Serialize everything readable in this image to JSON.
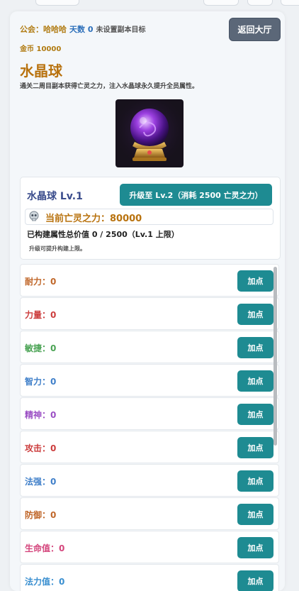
{
  "header": {
    "guild_label": "公会：哈哈哈",
    "days_label": "天数 0",
    "goal_label": "未设置副本目标",
    "gold_label": "金币 10000",
    "back_button": "返回大厅"
  },
  "crystal": {
    "title": "水晶球",
    "description": "通关二周目副本获得亡灵之力，注入水晶球永久提升全员属性。",
    "image_icon": "crystal-ball-icon",
    "level_label": "水晶球 Lv.1",
    "upgrade_button": "升级至 Lv.2（消耗 2500 亡灵之力）",
    "undead_power_label": "当前亡灵之力：80000",
    "total_label": "已构建属性总价值 0 / 2500（Lv.1 上限）",
    "hint": "升级可提升构建上限。"
  },
  "attributes": [
    {
      "label": "耐力：",
      "value": "0",
      "color": "#c0672a",
      "button": "加点"
    },
    {
      "label": "力量：",
      "value": "0",
      "color": "#cc3d3d",
      "button": "加点"
    },
    {
      "label": "敏捷：",
      "value": "0",
      "color": "#4aa354",
      "button": "加点"
    },
    {
      "label": "智力：",
      "value": "0",
      "color": "#3f7fc9",
      "button": "加点"
    },
    {
      "label": "精神：",
      "value": "0",
      "color": "#9b4fc4",
      "button": "加点"
    },
    {
      "label": "攻击：",
      "value": "0",
      "color": "#cc3d3d",
      "button": "加点"
    },
    {
      "label": "法强：",
      "value": "0",
      "color": "#3f7fc9",
      "button": "加点"
    },
    {
      "label": "防御：",
      "value": "0",
      "color": "#c0672a",
      "button": "加点"
    },
    {
      "label": "生命值：",
      "value": "0",
      "color": "#d4457c",
      "button": "加点"
    },
    {
      "label": "法力值：",
      "value": "0",
      "color": "#3a8fd0",
      "button": "加点"
    }
  ],
  "colors": {
    "accent": "#1e8b92",
    "gold": "#b8720e",
    "back_button": "#5b6778"
  }
}
